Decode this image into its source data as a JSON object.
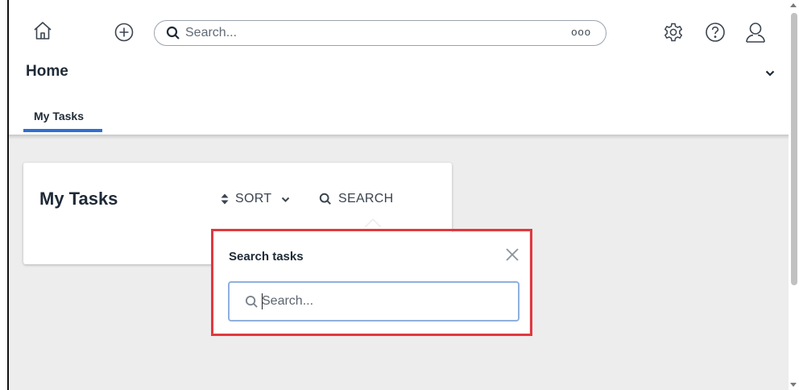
{
  "topbar": {
    "home_icon": "home-icon",
    "add_icon": "plus-circle-icon",
    "search": {
      "placeholder": "Search...",
      "more_label": "ooo"
    },
    "settings_icon": "gear-icon",
    "help_icon": "question-circle-icon",
    "user_icon": "user-icon"
  },
  "home": {
    "title": "Home",
    "tabs": [
      {
        "label": "My Tasks",
        "active": true
      }
    ]
  },
  "card": {
    "title": "My Tasks",
    "sort_label": "SORT",
    "search_label": "SEARCH"
  },
  "popup": {
    "title": "Search tasks",
    "input_placeholder": "Search..."
  },
  "colors": {
    "accent": "#2f6fd0",
    "highlight": "#e0393f",
    "page_bg": "#ededed"
  }
}
